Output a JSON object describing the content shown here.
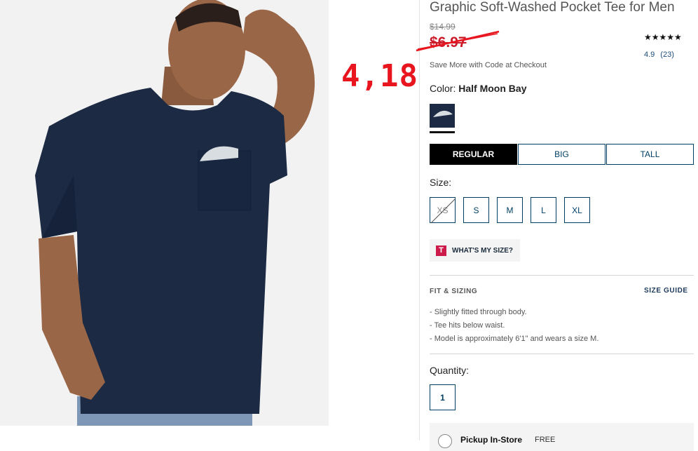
{
  "product": {
    "title": "Graphic Soft-Washed Pocket Tee for Men",
    "original_price": "$14.99",
    "sale_price": "$6.97",
    "annotation": "4,18",
    "promo_text": "Save More with Code at Checkout",
    "rating_stars": "★★★★★",
    "rating_value": "4.9",
    "review_count": "(23)"
  },
  "color": {
    "label": "Color:",
    "selected": "Half Moon Bay"
  },
  "fit_tabs": [
    {
      "label": "REGULAR",
      "active": true
    },
    {
      "label": "BIG",
      "active": false
    },
    {
      "label": "TALL",
      "active": false
    }
  ],
  "sizes": {
    "label": "Size:",
    "options": [
      "XS",
      "S",
      "M",
      "L",
      "XL"
    ]
  },
  "whats_my_size": {
    "icon_letter": "T",
    "label": "WHAT'S MY SIZE?"
  },
  "fit_sizing": {
    "heading": "FIT & SIZING",
    "guide_link": "SIZE GUIDE",
    "bullets": [
      "- Slightly fitted through body.",
      "- Tee hits below waist.",
      "- Model is approximately 6'1\" and wears a size M."
    ]
  },
  "quantity": {
    "label": "Quantity:",
    "value": "1"
  },
  "pickup": {
    "label": "Pickup In-Store",
    "price": "FREE"
  },
  "colors": {
    "navy": "#1c2a44",
    "link_blue": "#003f65",
    "sale_red": "#cc1b2b",
    "annotation_red": "#e8141e"
  }
}
